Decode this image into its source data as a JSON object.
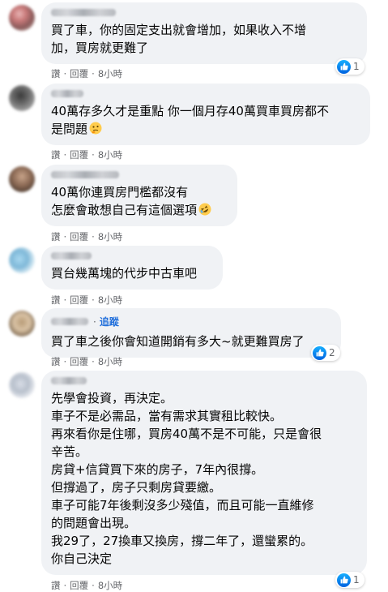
{
  "action_labels": {
    "like": "讚",
    "reply": "回覆",
    "separator": "·"
  },
  "comments": [
    {
      "lines": [
        "買了車，你的固定支出就會增加，如果收入不增",
        "加，買房就更難了"
      ],
      "time": "8小時",
      "reaction_count": "1"
    },
    {
      "lines": [
        "40萬存多久才是重點 你一個月存40萬買車買房都不",
        "是問題"
      ],
      "emoji": "thinking-face",
      "time": "8小時"
    },
    {
      "lines": [
        "40萬你連買房門檻都沒有",
        "怎麼會敢想自己有這個選項"
      ],
      "emoji": "rolling-laughing-face",
      "time": "8小時"
    },
    {
      "lines": [
        "買台幾萬塊的代步中古車吧"
      ],
      "time": "8小時"
    },
    {
      "follow_label": "追蹤",
      "lines": [
        "買了車之後你會知道開銷有多大~就更難買房了"
      ],
      "time": "8小時",
      "reaction_count": "2"
    },
    {
      "lines": [
        "先學會投資，再決定。",
        "車子不是必需品，當有需求其實租比較快。",
        "再來看你是住哪，買房40萬不是不可能，只是會很",
        "辛苦。",
        "房貸+信貸買下來的房子，7年內很撐。",
        "但撐過了，房子只剩房貸要繳。",
        "車子可能7年後剩沒多少殘值，而且可能一直維修",
        "的問題會出現。",
        "我29了，27換車又換房，撐二年了，還蠻累的。",
        "你自己決定"
      ],
      "time": "8小時",
      "reaction_count": "1"
    }
  ],
  "colors": {
    "bubble_bg": "#f0f2f5",
    "link_blue": "#216fdb",
    "meta_gray": "#65676b",
    "like_blue": "#1877f2"
  }
}
